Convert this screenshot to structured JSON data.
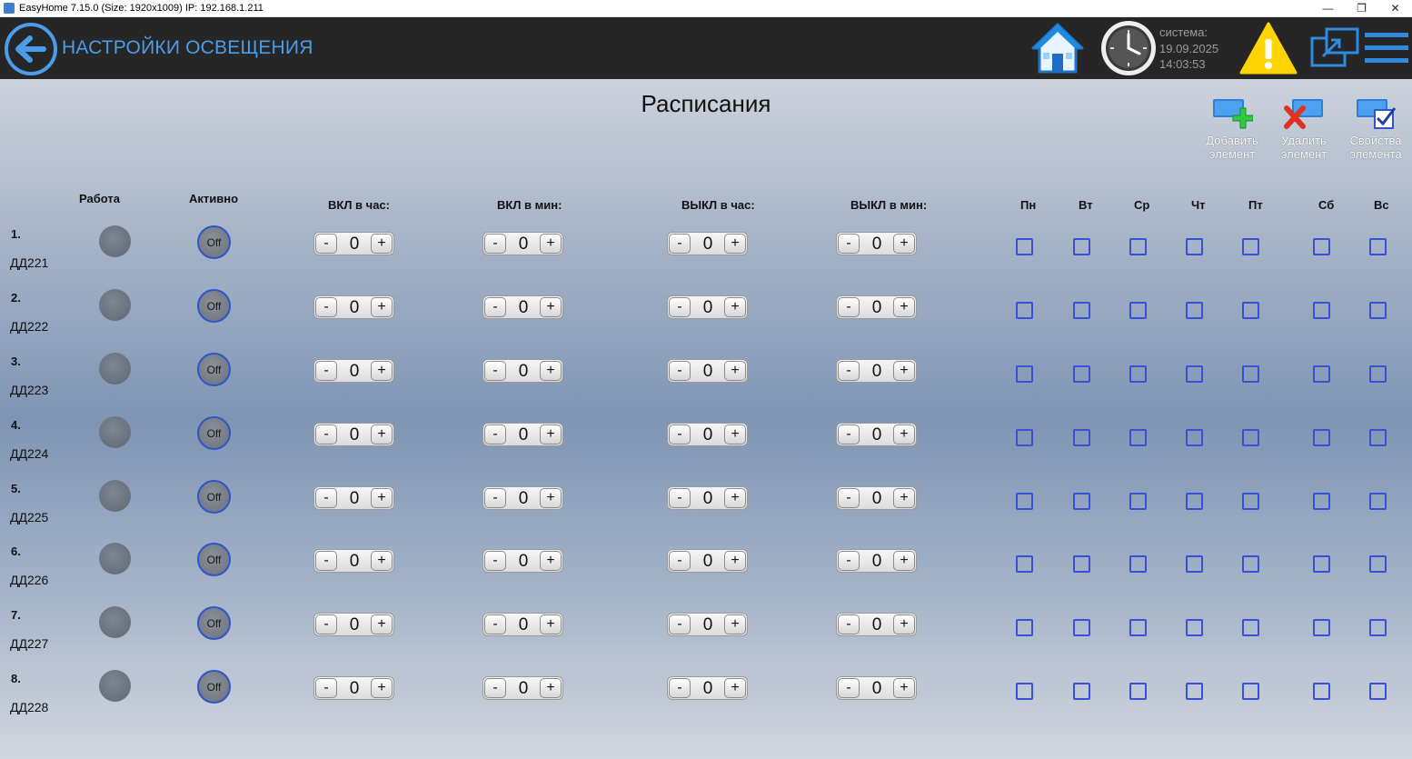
{
  "window": {
    "title": "EasyHome 7.15.0 (Size: 1920x1009) IP: 192.168.1.211",
    "minimize": "—",
    "restore": "❐",
    "close": "✕"
  },
  "header": {
    "title": "НАСТРОЙКИ ОСВЕЩЕНИЯ",
    "system_label": "система:",
    "date": "19.09.2025",
    "time": "14:03:53",
    "accent_color": "#4a9de8",
    "icons": [
      "back-arrow-icon",
      "home-icon",
      "clock-icon",
      "warning-icon",
      "popout-window-icon",
      "hamburger-menu-icon"
    ]
  },
  "main": {
    "title": "Расписания",
    "toolbar": [
      {
        "line1": "Добавить",
        "line2": "элемент",
        "icon": "add-element-icon"
      },
      {
        "line1": "Удалить",
        "line2": "элемент",
        "icon": "delete-element-icon"
      },
      {
        "line1": "Свойства",
        "line2": "элемента",
        "icon": "element-properties-icon"
      }
    ],
    "columns": {
      "work": "Работа",
      "active": "Активно",
      "on_hour": "ВКЛ в час:",
      "on_min": "ВКЛ в мин:",
      "off_hour": "ВЫКЛ в час:",
      "off_min": "ВЫКЛ в мин:",
      "days": [
        "Пн",
        "Вт",
        "Ср",
        "Чт",
        "Пт",
        "Сб",
        "Вс"
      ]
    },
    "stepper": {
      "minus": "-",
      "plus": "+"
    },
    "rows": [
      {
        "num": "1.",
        "name": "ДД221",
        "active": "Off",
        "on_hour": "0",
        "on_min": "0",
        "off_hour": "0",
        "off_min": "0",
        "days": [
          false,
          false,
          false,
          false,
          false,
          false,
          false
        ]
      },
      {
        "num": "2.",
        "name": "ДД222",
        "active": "Off",
        "on_hour": "0",
        "on_min": "0",
        "off_hour": "0",
        "off_min": "0",
        "days": [
          false,
          false,
          false,
          false,
          false,
          false,
          false
        ]
      },
      {
        "num": "3.",
        "name": "ДД223",
        "active": "Off",
        "on_hour": "0",
        "on_min": "0",
        "off_hour": "0",
        "off_min": "0",
        "days": [
          false,
          false,
          false,
          false,
          false,
          false,
          false
        ]
      },
      {
        "num": "4.",
        "name": "ДД224",
        "active": "Off",
        "on_hour": "0",
        "on_min": "0",
        "off_hour": "0",
        "off_min": "0",
        "days": [
          false,
          false,
          false,
          false,
          false,
          false,
          false
        ]
      },
      {
        "num": "5.",
        "name": "ДД225",
        "active": "Off",
        "on_hour": "0",
        "on_min": "0",
        "off_hour": "0",
        "off_min": "0",
        "days": [
          false,
          false,
          false,
          false,
          false,
          false,
          false
        ]
      },
      {
        "num": "6.",
        "name": "ДД226",
        "active": "Off",
        "on_hour": "0",
        "on_min": "0",
        "off_hour": "0",
        "off_min": "0",
        "days": [
          false,
          false,
          false,
          false,
          false,
          false,
          false
        ]
      },
      {
        "num": "7.",
        "name": "ДД227",
        "active": "Off",
        "on_hour": "0",
        "on_min": "0",
        "off_hour": "0",
        "off_min": "0",
        "days": [
          false,
          false,
          false,
          false,
          false,
          false,
          false
        ]
      },
      {
        "num": "8.",
        "name": "ДД228",
        "active": "Off",
        "on_hour": "0",
        "on_min": "0",
        "off_hour": "0",
        "off_min": "0",
        "days": [
          false,
          false,
          false,
          false,
          false,
          false,
          false
        ]
      }
    ]
  }
}
